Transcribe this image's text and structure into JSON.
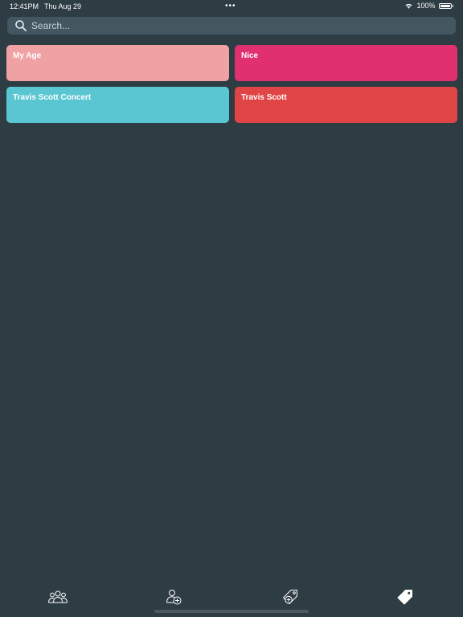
{
  "status_bar": {
    "time": "12:41PM",
    "date": "Thu Aug 29",
    "dots": "•••",
    "battery": "100%"
  },
  "search": {
    "placeholder": "Search..."
  },
  "cards": [
    {
      "label": "My Age",
      "color": "#f0a1a3"
    },
    {
      "label": "Nice",
      "color": "#e0306f"
    },
    {
      "label": "Travis Scott Concert",
      "color": "#5ac6d2"
    },
    {
      "label": "Travis Scott",
      "color": "#e14444"
    }
  ],
  "tabbar": {
    "items": [
      {
        "icon": "people-icon"
      },
      {
        "icon": "add-person-icon"
      },
      {
        "icon": "add-tag-icon"
      },
      {
        "icon": "tag-icon",
        "selected": true
      }
    ]
  }
}
